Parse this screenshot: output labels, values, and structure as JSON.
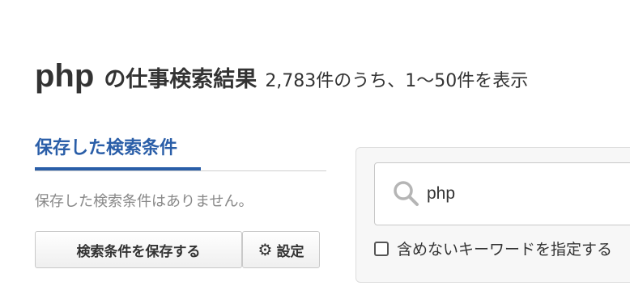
{
  "heading": {
    "keyword": "php",
    "suffix": "の仕事検索結果",
    "count_text": "2,783件のうち、1〜50件を表示"
  },
  "saved_searches": {
    "tab_label": "保存した検索条件",
    "empty_message": "保存した検索条件はありません。",
    "save_button_label": "検索条件を保存する",
    "settings_button_label": "設定"
  },
  "search": {
    "query_value": "php",
    "exclude_keywords_label": "含めないキーワードを指定する",
    "exclude_checked": false
  },
  "colors": {
    "accent": "#2a5ea8",
    "text": "#333333",
    "muted": "#888888"
  }
}
